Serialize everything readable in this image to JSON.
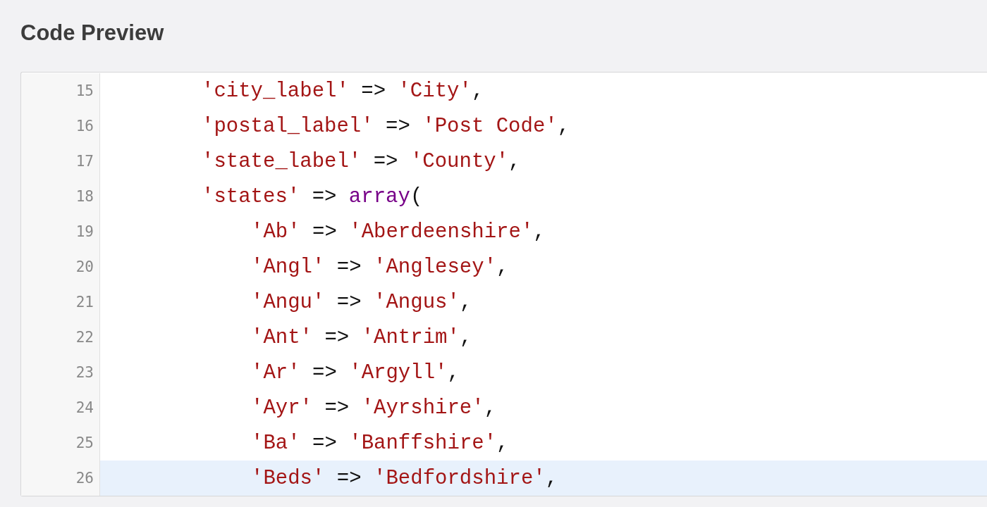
{
  "title": "Code Preview",
  "lines": [
    {
      "number": "15",
      "highlighted": false,
      "tokens": [
        {
          "kind": "string",
          "text": "'city_label'"
        },
        {
          "kind": "plain",
          "text": " => "
        },
        {
          "kind": "string",
          "text": "'City'"
        },
        {
          "kind": "plain",
          "text": ","
        }
      ]
    },
    {
      "number": "16",
      "highlighted": false,
      "tokens": [
        {
          "kind": "string",
          "text": "'postal_label'"
        },
        {
          "kind": "plain",
          "text": " => "
        },
        {
          "kind": "string",
          "text": "'Post Code'"
        },
        {
          "kind": "plain",
          "text": ","
        }
      ]
    },
    {
      "number": "17",
      "highlighted": false,
      "tokens": [
        {
          "kind": "string",
          "text": "'state_label'"
        },
        {
          "kind": "plain",
          "text": " => "
        },
        {
          "kind": "string",
          "text": "'County'"
        },
        {
          "kind": "plain",
          "text": ","
        }
      ]
    },
    {
      "number": "18",
      "highlighted": false,
      "tokens": [
        {
          "kind": "string",
          "text": "'states'"
        },
        {
          "kind": "plain",
          "text": " => "
        },
        {
          "kind": "keyword",
          "text": "array"
        },
        {
          "kind": "plain",
          "text": "("
        }
      ],
      "children": [
        {
          "number": "19",
          "highlighted": false,
          "tokens": [
            {
              "kind": "string",
              "text": "'Ab'"
            },
            {
              "kind": "plain",
              "text": " => "
            },
            {
              "kind": "string",
              "text": "'Aberdeenshire'"
            },
            {
              "kind": "plain",
              "text": ","
            }
          ]
        },
        {
          "number": "20",
          "highlighted": false,
          "tokens": [
            {
              "kind": "string",
              "text": "'Angl'"
            },
            {
              "kind": "plain",
              "text": " => "
            },
            {
              "kind": "string",
              "text": "'Anglesey'"
            },
            {
              "kind": "plain",
              "text": ","
            }
          ]
        },
        {
          "number": "21",
          "highlighted": false,
          "tokens": [
            {
              "kind": "string",
              "text": "'Angu'"
            },
            {
              "kind": "plain",
              "text": " => "
            },
            {
              "kind": "string",
              "text": "'Angus'"
            },
            {
              "kind": "plain",
              "text": ","
            }
          ]
        },
        {
          "number": "22",
          "highlighted": false,
          "tokens": [
            {
              "kind": "string",
              "text": "'Ant'"
            },
            {
              "kind": "plain",
              "text": " => "
            },
            {
              "kind": "string",
              "text": "'Antrim'"
            },
            {
              "kind": "plain",
              "text": ","
            }
          ]
        },
        {
          "number": "23",
          "highlighted": false,
          "tokens": [
            {
              "kind": "string",
              "text": "'Ar'"
            },
            {
              "kind": "plain",
              "text": " => "
            },
            {
              "kind": "string",
              "text": "'Argyll'"
            },
            {
              "kind": "plain",
              "text": ","
            }
          ]
        },
        {
          "number": "24",
          "highlighted": false,
          "tokens": [
            {
              "kind": "string",
              "text": "'Ayr'"
            },
            {
              "kind": "plain",
              "text": " => "
            },
            {
              "kind": "string",
              "text": "'Ayrshire'"
            },
            {
              "kind": "plain",
              "text": ","
            }
          ]
        },
        {
          "number": "25",
          "highlighted": false,
          "tokens": [
            {
              "kind": "string",
              "text": "'Ba'"
            },
            {
              "kind": "plain",
              "text": " => "
            },
            {
              "kind": "string",
              "text": "'Banffshire'"
            },
            {
              "kind": "plain",
              "text": ","
            }
          ]
        },
        {
          "number": "26",
          "highlighted": true,
          "tokens": [
            {
              "kind": "string",
              "text": "'Beds'"
            },
            {
              "kind": "plain",
              "text": " => "
            },
            {
              "kind": "string",
              "text": "'Bedfordshire'"
            },
            {
              "kind": "plain",
              "text": ","
            }
          ]
        }
      ]
    }
  ]
}
